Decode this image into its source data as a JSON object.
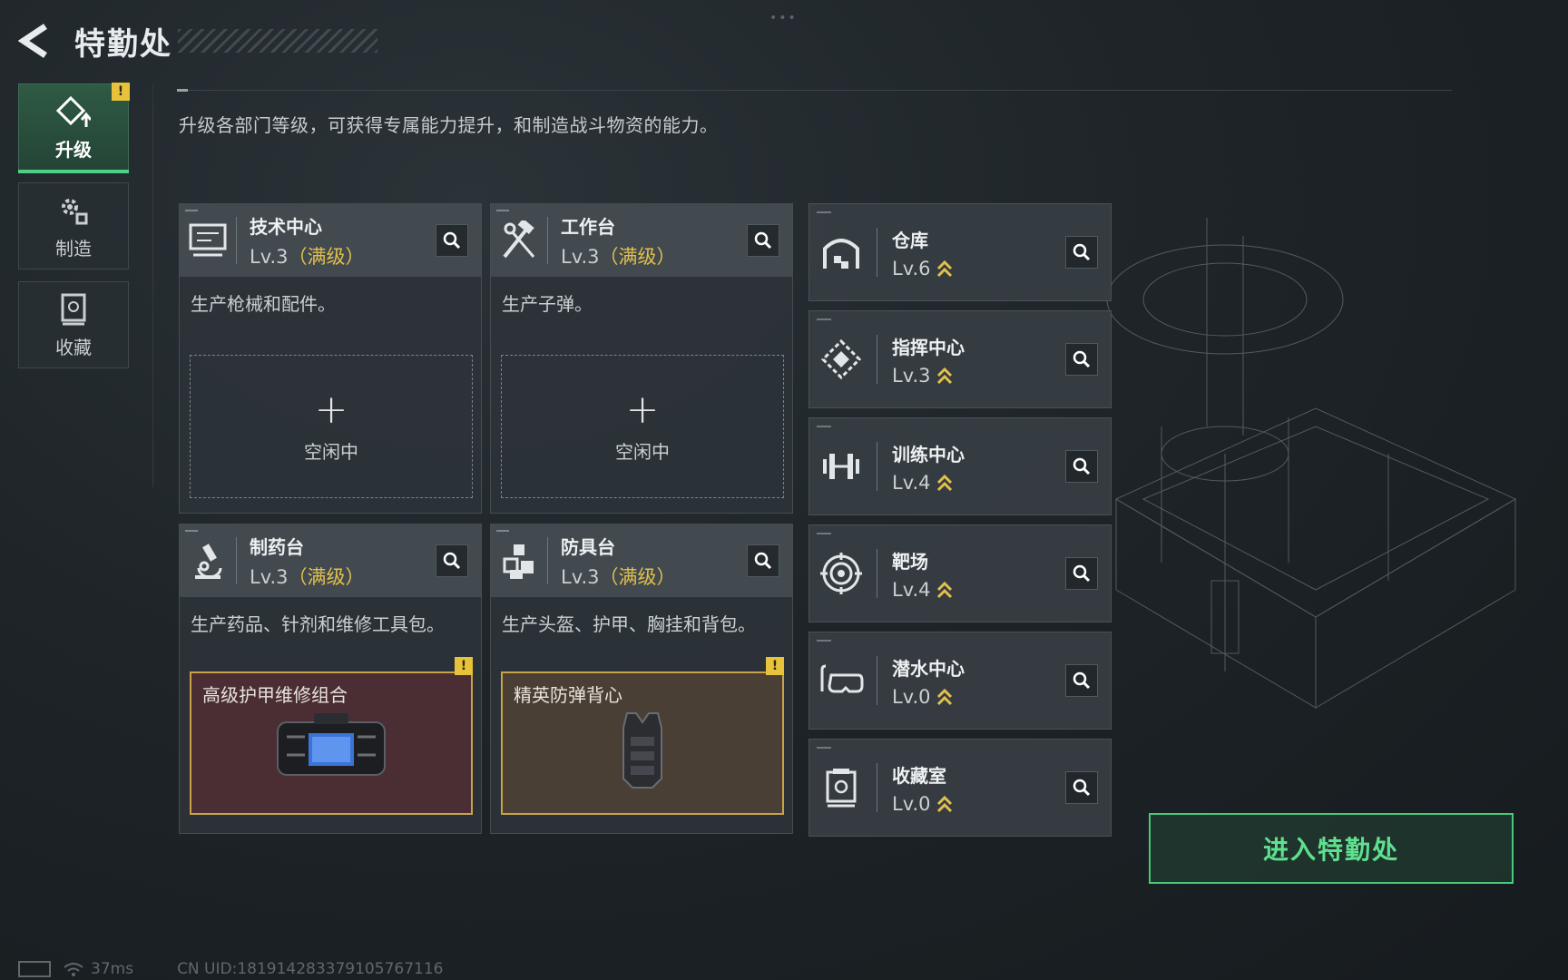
{
  "header": {
    "title": "特勤处"
  },
  "sidebar": {
    "items": [
      {
        "label": "升级",
        "icon": "upgrade-icon",
        "active": true,
        "alert": "!"
      },
      {
        "label": "制造",
        "icon": "gears-icon",
        "active": false
      },
      {
        "label": "收藏",
        "icon": "collection-icon",
        "active": false
      }
    ]
  },
  "description": "升级各部门等级，可获得专属能力提升，和制造战斗物资的能力。",
  "production": [
    {
      "name": "技术中心",
      "level": "Lv.3",
      "max": "（满级）",
      "desc": "生产枪械和配件。",
      "slot": {
        "state": "idle",
        "plus": "+",
        "label": "空闲中"
      }
    },
    {
      "name": "工作台",
      "level": "Lv.3",
      "max": "（满级）",
      "desc": "生产子弹。",
      "slot": {
        "state": "idle",
        "plus": "+",
        "label": "空闲中"
      }
    },
    {
      "name": "制药台",
      "level": "Lv.3",
      "max": "（满级）",
      "desc": "生产药品、针剂和维修工具包。",
      "slot": {
        "state": "item",
        "label": "高级护甲维修组合",
        "alert": "!"
      }
    },
    {
      "name": "防具台",
      "level": "Lv.3",
      "max": "（满级）",
      "desc": "生产头盔、护甲、胸挂和背包。",
      "slot": {
        "state": "item",
        "label": "精英防弹背心",
        "alert": "!"
      }
    }
  ],
  "facilities": [
    {
      "name": "仓库",
      "level": "Lv.6",
      "icon": "warehouse-icon"
    },
    {
      "name": "指挥中心",
      "level": "Lv.3",
      "icon": "command-center-icon"
    },
    {
      "name": "训练中心",
      "level": "Lv.4",
      "icon": "dumbbell-icon"
    },
    {
      "name": "靶场",
      "level": "Lv.4",
      "icon": "target-icon"
    },
    {
      "name": "潜水中心",
      "level": "Lv.0",
      "icon": "diving-mask-icon"
    },
    {
      "name": "收藏室",
      "level": "Lv.0",
      "icon": "collection-room-icon"
    }
  ],
  "enter_button": {
    "label": "进入特勤处"
  },
  "footer": {
    "ping": "37ms",
    "uid": "CN UID:181914283379105767116"
  },
  "colors": {
    "accent_green": "#4fcf87",
    "max_gold": "#e1c04b",
    "alert_yellow": "#e7c23a"
  }
}
